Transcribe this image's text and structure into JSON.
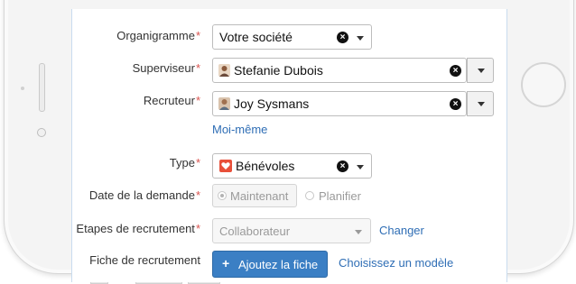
{
  "form": {
    "organigramme": {
      "label": "Organigramme",
      "value": "Votre société"
    },
    "superviseur": {
      "label": "Superviseur",
      "value": "Stefanie Dubois"
    },
    "recruteur": {
      "label": "Recruteur",
      "value": "Joy Sysmans",
      "self_link": "Moi-même"
    },
    "type": {
      "label": "Type",
      "value": "Bénévoles",
      "icon": "heart-icon",
      "icon_color": "#e8503a"
    },
    "date_demande": {
      "label": "Date de la demande",
      "options": [
        "Maintenant",
        "Planifier"
      ],
      "selected": "Maintenant"
    },
    "etapes": {
      "label": "Etapes de recrutement",
      "value": "Collaborateur",
      "change_link": "Changer"
    },
    "fiche": {
      "label": "Fiche de recrutement",
      "button_label": "Ajoutez la fiche",
      "model_link": "Choisissez un modèle"
    },
    "required_mark": "*"
  },
  "colors": {
    "accent": "#2f6eb5",
    "required": "#d9534f",
    "primary_button": "#3b7fc4"
  }
}
